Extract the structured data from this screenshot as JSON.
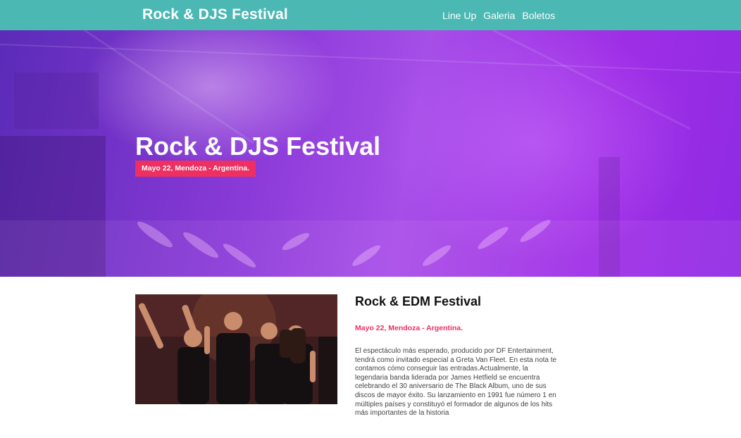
{
  "header": {
    "brand": "Rock & DJS Festival",
    "nav": [
      "Line Up",
      "Galeria",
      "Boletos"
    ]
  },
  "hero": {
    "title": "Rock & DJS Festival",
    "badge": "Mayo 22, Mendoza - Argentina."
  },
  "info": {
    "title": "Rock & EDM Festival",
    "date": "Mayo 22, Mendoza - Argentina.",
    "text": "El espectáculo más esperado, producido por DF Entertainment, tendrá como invitado especial a Greta Van Fleet. En esta nota te contamos cómo conseguir las entradas.Actualmente, la legendaria banda liderada por James Hetfield se encuentra celebrando el 30 aniversario de The Black Album, uno de sus discos de mayor éxito. Su lanzamiento en 1991 fue número 1 en múltiples países y constituyó el formador de algunos de los hits más importantes de la historia"
  },
  "colors": {
    "navbar": "#4bb8b3",
    "accent": "#ee2f61",
    "hero_purple": "#9e2ee6"
  }
}
